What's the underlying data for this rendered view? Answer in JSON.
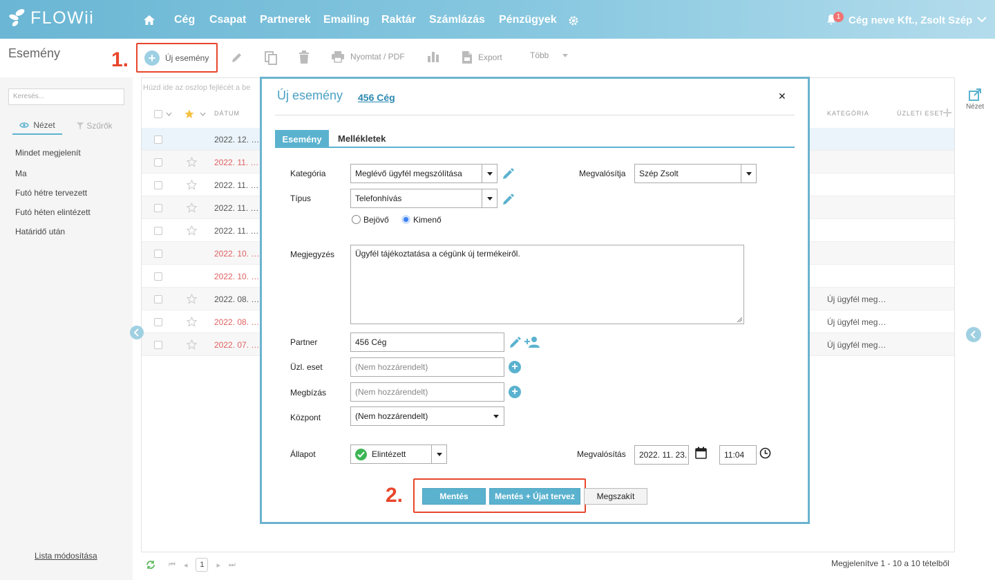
{
  "app": {
    "name": "FLOWii"
  },
  "topnav": {
    "items": [
      "Cég",
      "Csapat",
      "Partnerek",
      "Emailing",
      "Raktár",
      "Számlázás",
      "Pénzügyek"
    ],
    "notification_count": "1",
    "company_user": "Cég neve Kft., Zsolt Szép"
  },
  "page": {
    "title": "Esemény"
  },
  "toolbar": {
    "new_event": "Új esemény",
    "print_pdf": "Nyomtat / PDF",
    "export": "Export",
    "more": "Több"
  },
  "annotations": {
    "step1": "1.",
    "step2": "2."
  },
  "sidebar": {
    "search_placeholder": "Keresés...",
    "view_tab": "Nézet",
    "filter_tab": "Szűrők",
    "items": [
      "Mindet megjelenít",
      "Ma",
      "Futó hétre tervezett",
      "Futó héten elintézett",
      "Határidő után"
    ],
    "list_edit": "Lista módosítása"
  },
  "grid": {
    "group_hint": "Húzd ide az oszlop fejlécét a be",
    "columns": {
      "date": "DÁTUM",
      "category": "KATEGÓRIA",
      "business_case": "ÜZLETI ESET"
    },
    "rows": [
      {
        "date": "2022. 12. …",
        "starred": false,
        "overdue": false,
        "category": ""
      },
      {
        "date": "2022. 11. …",
        "starred": true,
        "overdue": true,
        "category": ""
      },
      {
        "date": "2022. 11. …",
        "starred": true,
        "overdue": false,
        "category": ""
      },
      {
        "date": "2022. 11. …",
        "starred": true,
        "overdue": false,
        "category": ""
      },
      {
        "date": "2022. 11. …",
        "starred": true,
        "overdue": false,
        "category": ""
      },
      {
        "date": "2022. 10. …",
        "starred": false,
        "overdue": true,
        "category": ""
      },
      {
        "date": "2022. 10. …",
        "starred": false,
        "overdue": true,
        "category": ""
      },
      {
        "date": "2022. 08. …",
        "starred": true,
        "overdue": false,
        "category": "Új ügyfél meg…"
      },
      {
        "date": "2022. 08. …",
        "starred": true,
        "overdue": true,
        "category": "Új ügyfél meg…"
      },
      {
        "date": "2022. 07. …",
        "starred": true,
        "overdue": true,
        "category": "Új ügyfél meg…"
      }
    ],
    "right_panel_label": "Nézet",
    "page_number": "1",
    "records_text": "Megjelenítve 1 - 10 a 10 tételből"
  },
  "modal": {
    "title": "Új esemény",
    "partner_link": "456 Cég",
    "tabs": {
      "active": "Esemény",
      "other": "Mellékletek"
    },
    "labels": {
      "category": "Kategória",
      "type": "Típus",
      "note": "Megjegyzés",
      "partner": "Partner",
      "business_case": "Üzl. eset",
      "assignment": "Megbízás",
      "center": "Központ",
      "status": "Állapot",
      "realized_by": "Megvalósítja",
      "realization": "Megvalósítás"
    },
    "values": {
      "category": "Meglévő ügyfél megszólítása",
      "type": "Telefonhívás",
      "direction_in": "Bejövő",
      "direction_out": "Kimenő",
      "note": "Ügyfél tájékoztatása a cégünk új termékeiről.",
      "partner": "456 Cég",
      "business_case_placeholder": "(Nem hozzárendelt)",
      "assignment_placeholder": "(Nem hozzárendelt)",
      "center": "(Nem hozzárendelt)",
      "status": "Elintézett",
      "realized_by": "Szép Zsolt",
      "date": "2022. 11. 23.",
      "time": "11:04"
    },
    "buttons": {
      "save": "Mentés",
      "save_new": "Mentés + Újat tervez",
      "cancel": "Megszakít"
    }
  },
  "colors": {
    "accent": "#5ab2cf",
    "overdue": "#e06060",
    "annotation": "#e8462b",
    "status_ok": "#3cb554"
  }
}
